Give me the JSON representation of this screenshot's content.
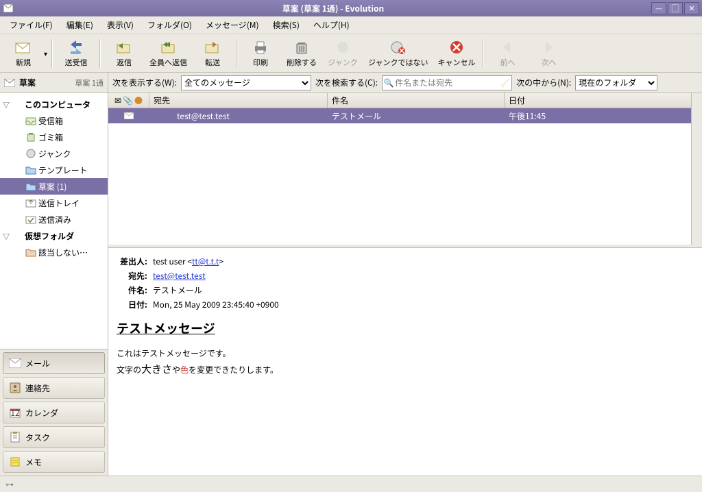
{
  "window": {
    "title": "草案 (草案 1通) - Evolution"
  },
  "menu": {
    "file": "ファイル(F)",
    "edit": "編集(E)",
    "view": "表示(V)",
    "folder": "フォルダ(O)",
    "message": "メッセージ(M)",
    "search": "検索(S)",
    "help": "ヘルプ(H)"
  },
  "toolbar": {
    "new": "新規",
    "sendrecv": "送受信",
    "reply": "返信",
    "replyall": "全員へ返信",
    "forward": "転送",
    "print": "印刷",
    "delete": "削除する",
    "junk": "ジャンク",
    "notjunk": "ジャンクではない",
    "cancel": "キャンセル",
    "prev": "前へ",
    "next": "次へ"
  },
  "filterbar": {
    "show_label": "次を表示する(W):",
    "show_value": "全てのメッセージ",
    "search_label": "次を検索する(C):",
    "search_placeholder": "件名または宛先",
    "scope_label": "次の中から(N):",
    "scope_value": "現在のフォルダ"
  },
  "sidebar": {
    "header_title": "草案",
    "header_count": "草案 1通",
    "tree": [
      {
        "type": "header",
        "label": "このコンピュータ"
      },
      {
        "type": "child",
        "icon": "inbox",
        "label": "受信箱"
      },
      {
        "type": "child",
        "icon": "trash",
        "label": "ゴミ箱"
      },
      {
        "type": "child",
        "icon": "junk",
        "label": "ジャンク"
      },
      {
        "type": "child",
        "icon": "folder",
        "label": "テンプレート"
      },
      {
        "type": "child",
        "icon": "folder",
        "label": "草案 (1)",
        "selected": true
      },
      {
        "type": "child",
        "icon": "outbox",
        "label": "送信トレイ"
      },
      {
        "type": "child",
        "icon": "sent",
        "label": "送信済み"
      },
      {
        "type": "header",
        "label": "仮想フォルダ"
      },
      {
        "type": "child",
        "icon": "vfolder",
        "label": "該当しない…"
      }
    ],
    "switcher": [
      {
        "label": "メール",
        "icon": "mail",
        "active": true
      },
      {
        "label": "連絡先",
        "icon": "contacts"
      },
      {
        "label": "カレンダ",
        "icon": "calendar"
      },
      {
        "label": "タスク",
        "icon": "tasks"
      },
      {
        "label": "メモ",
        "icon": "memo"
      }
    ]
  },
  "list": {
    "headers": {
      "to": "宛先",
      "subject": "件名",
      "date": "日付"
    },
    "rows": [
      {
        "to": "test@test.test",
        "subject": "テストメール",
        "date": "午後11:45",
        "selected": true
      }
    ]
  },
  "preview": {
    "labels": {
      "from": "差出人:",
      "to": "宛先:",
      "subject": "件名:",
      "date": "日付:"
    },
    "from_name": "test user",
    "from_email": "tt@t.t.t",
    "to": "test@test.test",
    "subject": "テストメール",
    "date": "Mon, 25 May 2009 23:45:40 +0900",
    "body_title": "テストメッセージ",
    "body_line1": "これはテストメッセージです。",
    "body_line2_a": "文字の",
    "body_line2_big": "大きさ",
    "body_line2_b": "や",
    "body_line2_color": "色",
    "body_line2_c": "を変更できたりします。"
  }
}
